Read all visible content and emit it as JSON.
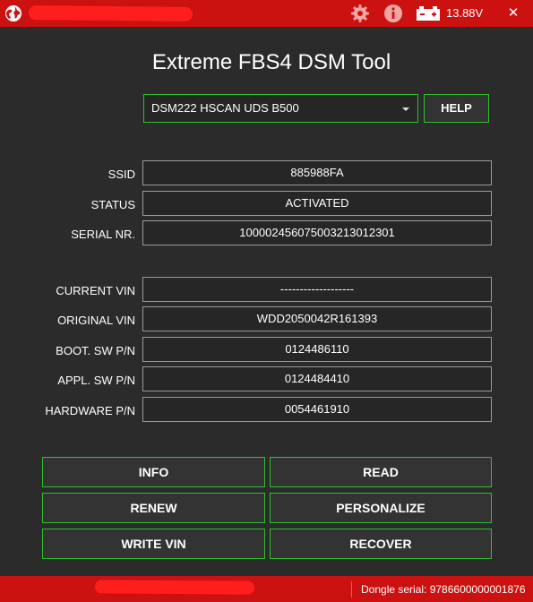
{
  "topbar": {
    "battery_voltage": "13.88V",
    "close_glyph": "✕",
    "icons": [
      "globe-icon",
      "gear-icon",
      "info-icon",
      "battery-icon",
      "close-icon"
    ],
    "color": "#cc1111"
  },
  "app": {
    "title": "Extreme FBS4 DSM Tool"
  },
  "device_select": {
    "selected": "DSM222 HSCAN UDS B500"
  },
  "help_button": "HELP",
  "info_rows": [
    {
      "label": "SSID",
      "value": "885988FA"
    },
    {
      "label": "STATUS",
      "value": "ACTIVATED"
    },
    {
      "label": "SERIAL NR.",
      "value": "10000245607500321301230 1"
    }
  ],
  "vehicle_rows": [
    {
      "label": "CURRENT VIN",
      "value": "-------------------"
    },
    {
      "label": "ORIGINAL VIN",
      "value": "WDD2050042R161393"
    },
    {
      "label": "BOOT. SW P/N",
      "value": "0124486110"
    },
    {
      "label": "APPL. SW P/N",
      "value": "0124484410"
    },
    {
      "label": "HARDWARE P/N",
      "value": "0054461910"
    }
  ],
  "actions": {
    "info": "INFO",
    "read": "READ",
    "renew": "RENEW",
    "personalize": "PERSONALIZE",
    "write_vin": "WRITE VIN",
    "recover": "RECOVER"
  },
  "statusbar": {
    "dongle_serial": "Dongle serial: 9786600000001876"
  },
  "colors": {
    "accent_green": "#2fbf2f",
    "bar_red": "#cc1111",
    "background": "#2b2b2b"
  }
}
